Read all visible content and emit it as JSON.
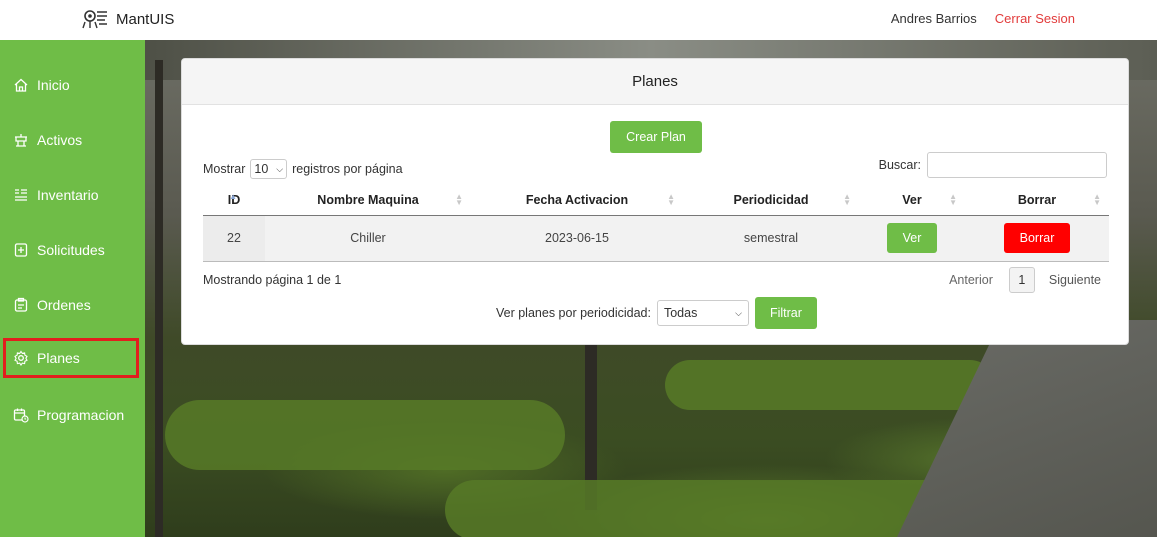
{
  "header": {
    "brand_name": "MantUIS",
    "logo_icon": "robot-logo-icon",
    "user_name": "Andres Barrios",
    "logout_label": "Cerrar Sesion"
  },
  "sidebar": {
    "items": [
      {
        "label": "Inicio",
        "icon": "home-icon"
      },
      {
        "label": "Activos",
        "icon": "asset-icon"
      },
      {
        "label": "Inventario",
        "icon": "inventory-icon"
      },
      {
        "label": "Solicitudes",
        "icon": "request-icon"
      },
      {
        "label": "Ordenes",
        "icon": "orders-icon"
      },
      {
        "label": "Planes",
        "icon": "gear-icon"
      },
      {
        "label": "Programacion",
        "icon": "calendar-icon"
      }
    ],
    "active_item": "Planes"
  },
  "card": {
    "title": "Planes",
    "create_button": "Crear Plan",
    "length": {
      "prefix": "Mostrar",
      "value": "10",
      "suffix": "registros por página"
    },
    "search_label": "Buscar:",
    "search_value": "",
    "table": {
      "headers": [
        "ID",
        "Nombre Maquina",
        "Fecha Activacion",
        "Periodicidad",
        "Ver",
        "Borrar"
      ],
      "rows": [
        {
          "id": "22",
          "name": "Chiller",
          "date": "2023-06-15",
          "period": "semestral",
          "view_label": "Ver",
          "delete_label": "Borrar"
        }
      ]
    },
    "info": "Mostrando página 1 de 1",
    "pagination": {
      "prev": "Anterior",
      "page": "1",
      "next": "Siguiente"
    },
    "filter": {
      "label": "Ver planes por periodicidad:",
      "value": "Todas",
      "button": "Filtrar"
    }
  },
  "colors": {
    "accent_green": "#6fbd47",
    "danger_red": "#ff0000",
    "logout_red": "#e23b3b",
    "active_outline": "#e21e1e"
  }
}
